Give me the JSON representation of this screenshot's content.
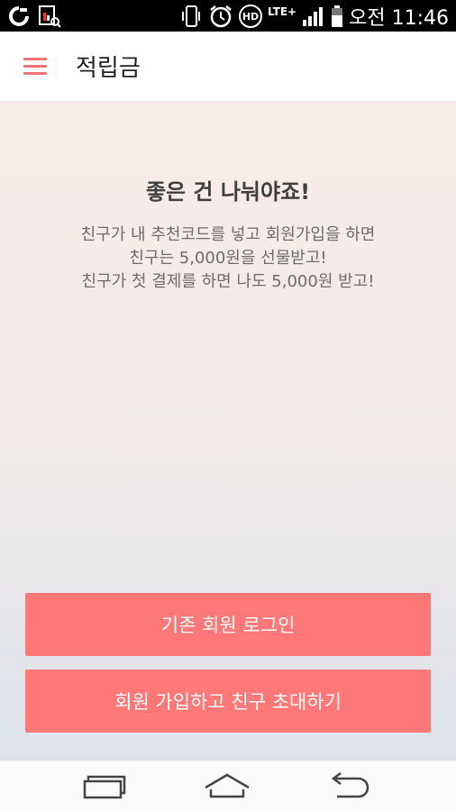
{
  "status_bar": {
    "time": "오전 11:46",
    "network_label": "LTE+",
    "hd_label": "HD"
  },
  "app_bar": {
    "title": "적립금"
  },
  "promo": {
    "headline": "좋은 건 나눠야죠!",
    "lines": [
      "친구가 내 추천코드를 넣고 회원가입을 하면",
      "친구는 5,000원을 선물받고!",
      "친구가 첫 결제를 하면 나도 5,000원 받고!"
    ]
  },
  "buttons": {
    "login": "기존 회원 로그인",
    "signup_invite": "회원 가입하고 친구 초대하기"
  },
  "colors": {
    "accent": "#ff7878",
    "menu_icon": "#f07474"
  }
}
